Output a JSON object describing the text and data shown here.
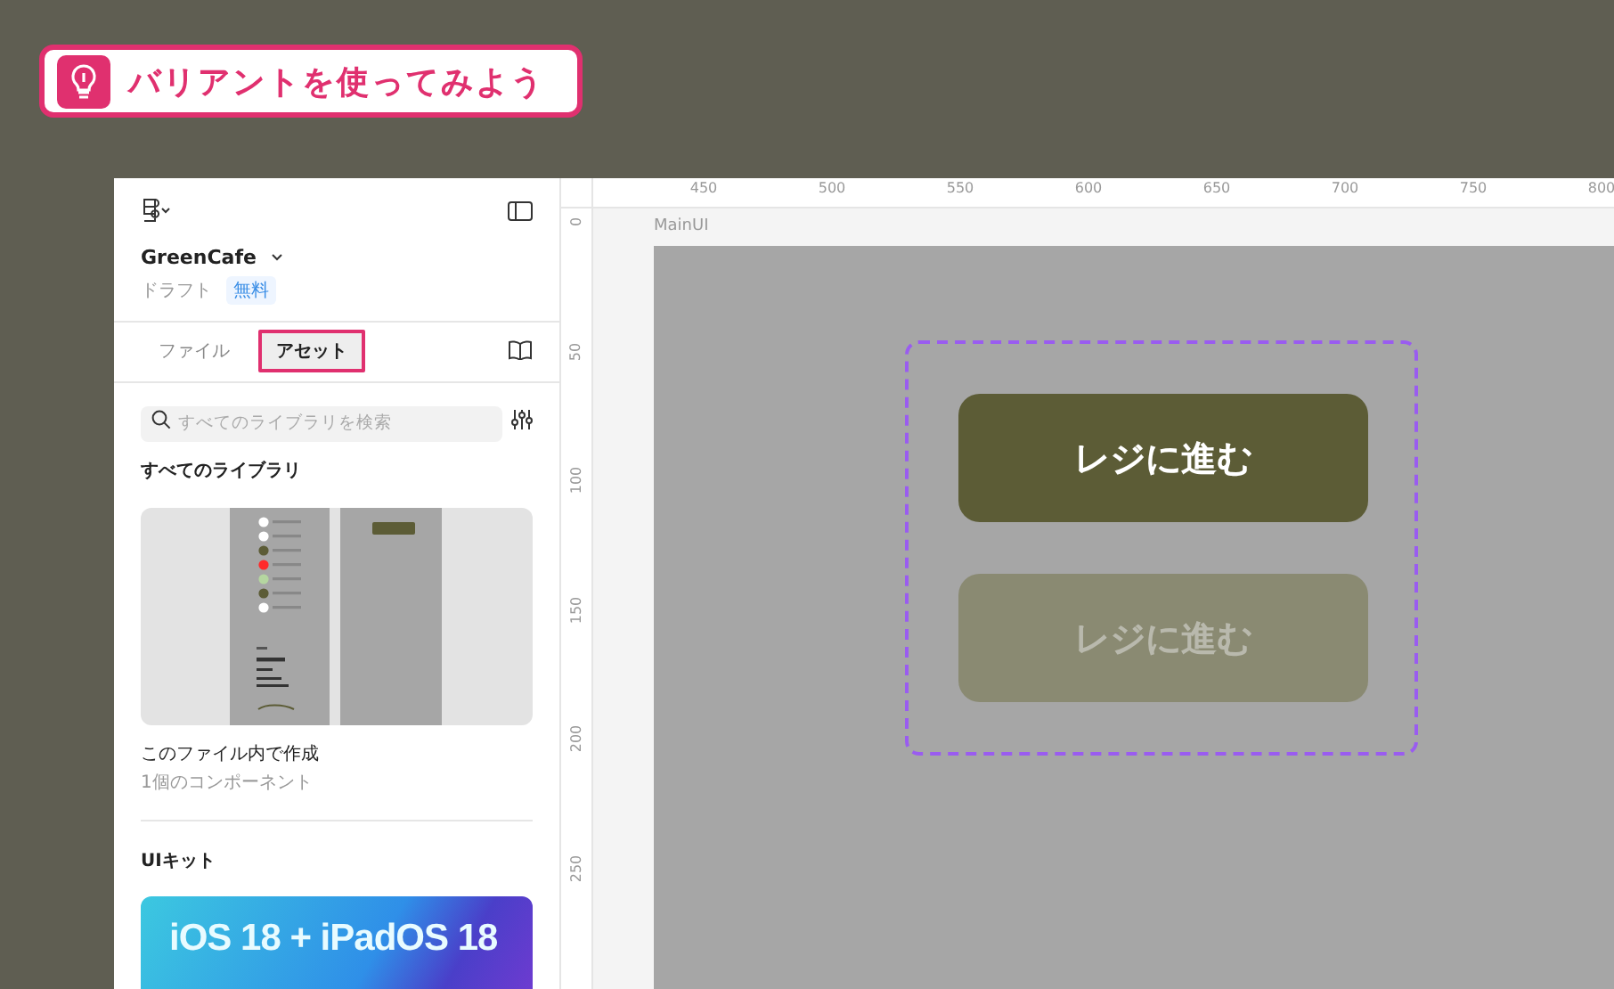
{
  "callout": {
    "text": "バリアントを使ってみよう"
  },
  "file": {
    "name": "GreenCafe",
    "location": "ドラフト",
    "plan": "無料"
  },
  "tabs": [
    {
      "label": "ファイル",
      "selected": false,
      "highlighted": false
    },
    {
      "label": "アセット",
      "selected": true,
      "highlighted": true
    }
  ],
  "search": {
    "placeholder": "すべてのライブラリを検索"
  },
  "libraries": {
    "heading": "すべてのライブラリ",
    "title": "このファイル内で作成",
    "subtitle": "1個のコンポーネント"
  },
  "ui_kits": {
    "heading": "UIキット",
    "banner_lines": [
      "iOS 18 + iPadOS 18"
    ]
  },
  "ruler": {
    "x_ticks": [
      "450",
      "500",
      "550",
      "600",
      "650",
      "700",
      "750",
      "800"
    ],
    "y_ticks": [
      "0",
      "50",
      "100",
      "150",
      "200",
      "250"
    ]
  },
  "frame": {
    "label": "MainUI"
  },
  "buttons": [
    {
      "label": "レジに進む",
      "kind": "default"
    },
    {
      "label": "レジに進む",
      "kind": "disabled"
    }
  ]
}
